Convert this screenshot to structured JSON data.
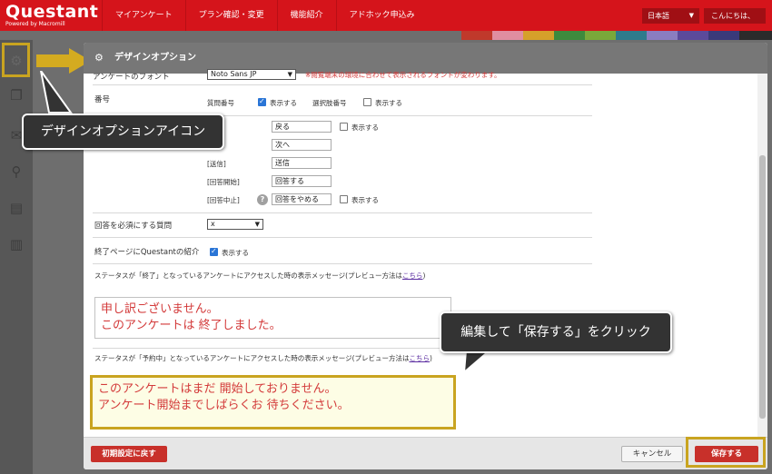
{
  "logo": {
    "name": "Questant",
    "sub": "Powered by Macromill"
  },
  "nav": [
    "マイアンケート",
    "プラン確認・変更",
    "機能紹介",
    "アドホック申込み"
  ],
  "lang": "日本語",
  "greeting": "こんにちは、",
  "colors": {
    "brand": "#d5141b",
    "highlight": "#c9a420",
    "message": "#d33a3a"
  },
  "dialog": {
    "title": "デザインオプション",
    "font_label": "アンケートのフォント",
    "font_value": "Noto Sans JP",
    "font_note": "※閲覧端末の環境に合わせて表示されるフォントが変わります。",
    "number_label": "番号",
    "q_number_label": "質問番号",
    "show_label": "表示する",
    "choice_number_label": "選択肢番号",
    "buttons": {
      "back_value": "戻る",
      "next_value": "次へ",
      "send_tag": "[送信]",
      "send_value": "送信",
      "start_tag": "[回答開始]",
      "start_value": "回答する",
      "stop_tag": "[回答中止]",
      "stop_value": "回答をやめる"
    },
    "required_label": "回答を必須にする質問",
    "required_value": "x",
    "intro_label": "終了ページにQuestantの紹介",
    "closed_label": "ステータスが「終了」となっているアンケートにアクセスした時の表示メッセージ(プレビュー方法は",
    "link_text": "こちら",
    "closed_message_1": "申し訳ございません。",
    "closed_message_2": "このアンケートは 終了しました。",
    "scheduled_label": "ステータスが「予約中」となっているアンケートにアクセスした時の表示メッセージ(プレビュー方法は",
    "scheduled_message_1": "このアンケートはまだ 開始しておりません。",
    "scheduled_message_2": "アンケート開始までしばらくお 待ちください。",
    "reset_button": "初期設定に戻す",
    "cancel_button": "キャンセル",
    "save_button": "保存する"
  },
  "callouts": {
    "icon": "デザインオプションアイコン",
    "save": "編集して「保存する」をクリック"
  },
  "icons": [
    "gear-icon",
    "copy-icon",
    "share-icon",
    "search-icon",
    "print-icon",
    "trash-icon"
  ]
}
